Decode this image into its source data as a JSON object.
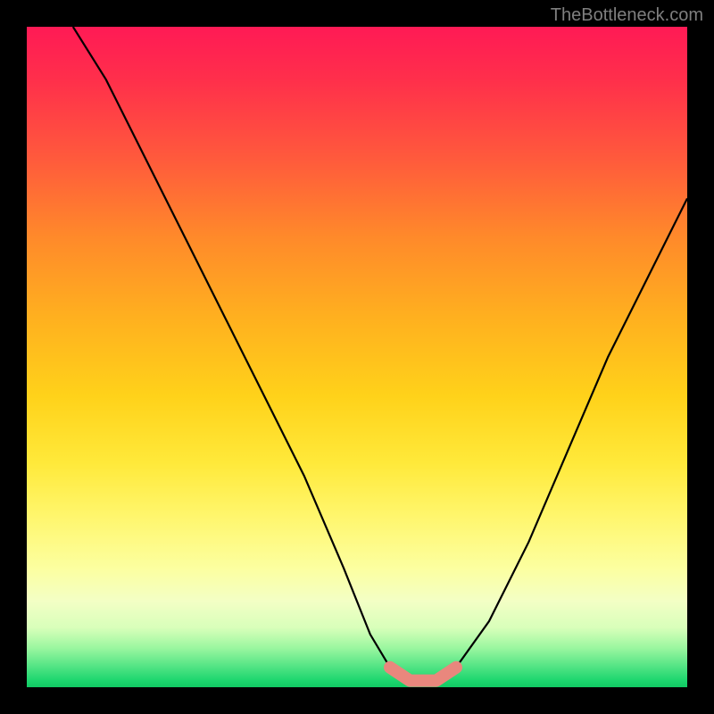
{
  "watermark": "TheBottleneck.com",
  "chart_data": {
    "type": "line",
    "title": "",
    "xlabel": "",
    "ylabel": "",
    "xlim": [
      0,
      100
    ],
    "ylim": [
      0,
      100
    ],
    "series": [
      {
        "name": "curve",
        "x": [
          7,
          12,
          18,
          24,
          30,
          36,
          42,
          48,
          52,
          55,
          58,
          62,
          65,
          70,
          76,
          82,
          88,
          94,
          100
        ],
        "values": [
          100,
          92,
          80,
          68,
          56,
          44,
          32,
          18,
          8,
          3,
          1,
          1,
          3,
          10,
          22,
          36,
          50,
          62,
          74
        ]
      },
      {
        "name": "highlight",
        "x": [
          55,
          58,
          62,
          65
        ],
        "values": [
          3,
          1,
          1,
          3
        ]
      }
    ],
    "colors": {
      "curve": "#000000",
      "highlight": "#e9877d",
      "gradient_top": "#ff1a55",
      "gradient_bottom": "#12c964"
    }
  }
}
